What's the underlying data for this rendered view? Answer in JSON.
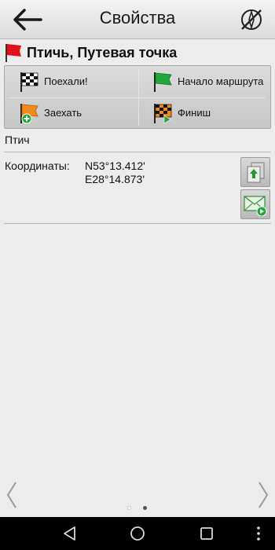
{
  "header": {
    "title": "Свойства",
    "back_icon": "arrow-left-icon",
    "compass_icon": "no-compass-icon"
  },
  "poi": {
    "name": "Птичь, Путевая точка",
    "flag_color": "#e0101c"
  },
  "actions": {
    "go": "Поехали!",
    "route_start": "Начало маршрута",
    "visit": "Заехать",
    "finish": "Финиш"
  },
  "category": "Птич",
  "coordinates": {
    "label": "Координаты:",
    "lat": "N53°13.412'",
    "lon": "E28°14.873'"
  },
  "side_buttons": {
    "export_icon": "export-icon",
    "send_icon": "send-message-icon"
  },
  "pager": {
    "dots": 2,
    "active": 2
  },
  "system_nav": {
    "back": "nav-back-icon",
    "home": "nav-home-icon",
    "recent": "nav-recent-icon",
    "menu": "nav-menu-icon"
  }
}
